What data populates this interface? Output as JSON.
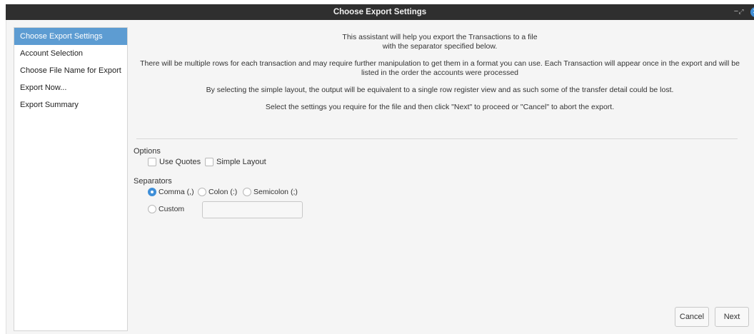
{
  "window": {
    "title": "Choose Export Settings",
    "controls": {
      "minimize": "−",
      "maximize": "⤢",
      "close": "✕"
    }
  },
  "sidebar": {
    "items": [
      {
        "label": "Choose Export Settings",
        "active": true
      },
      {
        "label": "Account Selection",
        "active": false
      },
      {
        "label": "Choose File Name for Export",
        "active": false
      },
      {
        "label": "Export Now...",
        "active": false
      },
      {
        "label": "Export Summary",
        "active": false
      }
    ]
  },
  "intro": {
    "line1": "This assistant will help you export the Transactions to a file",
    "line2": "with the separator specified below.",
    "para2_line1": "There will be multiple rows for each transaction and may require further manipulation to get them in a format you can use. Each Transaction will appear once in the export and will be",
    "para2_line2": "listed in the order the accounts were processed",
    "para3": "By selecting the simple layout, the output will be equivalent to a single row register view and as such some of the transfer detail could be lost.",
    "para4": "Select the settings you require for the file and then click \"Next\" to proceed or \"Cancel\" to abort the export."
  },
  "options": {
    "label": "Options",
    "use_quotes": {
      "label": "Use Quotes",
      "checked": false
    },
    "simple_layout": {
      "label": "Simple Layout",
      "checked": false
    }
  },
  "separators": {
    "label": "Separators",
    "comma": {
      "label": "Comma (,)",
      "selected": true
    },
    "colon": {
      "label": "Colon (:)",
      "selected": false
    },
    "semicolon": {
      "label": "Semicolon (;)",
      "selected": false
    },
    "custom": {
      "label": "Custom",
      "selected": false,
      "value": ""
    }
  },
  "buttons": {
    "cancel": "Cancel",
    "next": "Next"
  },
  "colors": {
    "accent": "#5d9cd2",
    "radio_selected": "#3f8fd8",
    "titlebar": "#2f2f2f"
  }
}
